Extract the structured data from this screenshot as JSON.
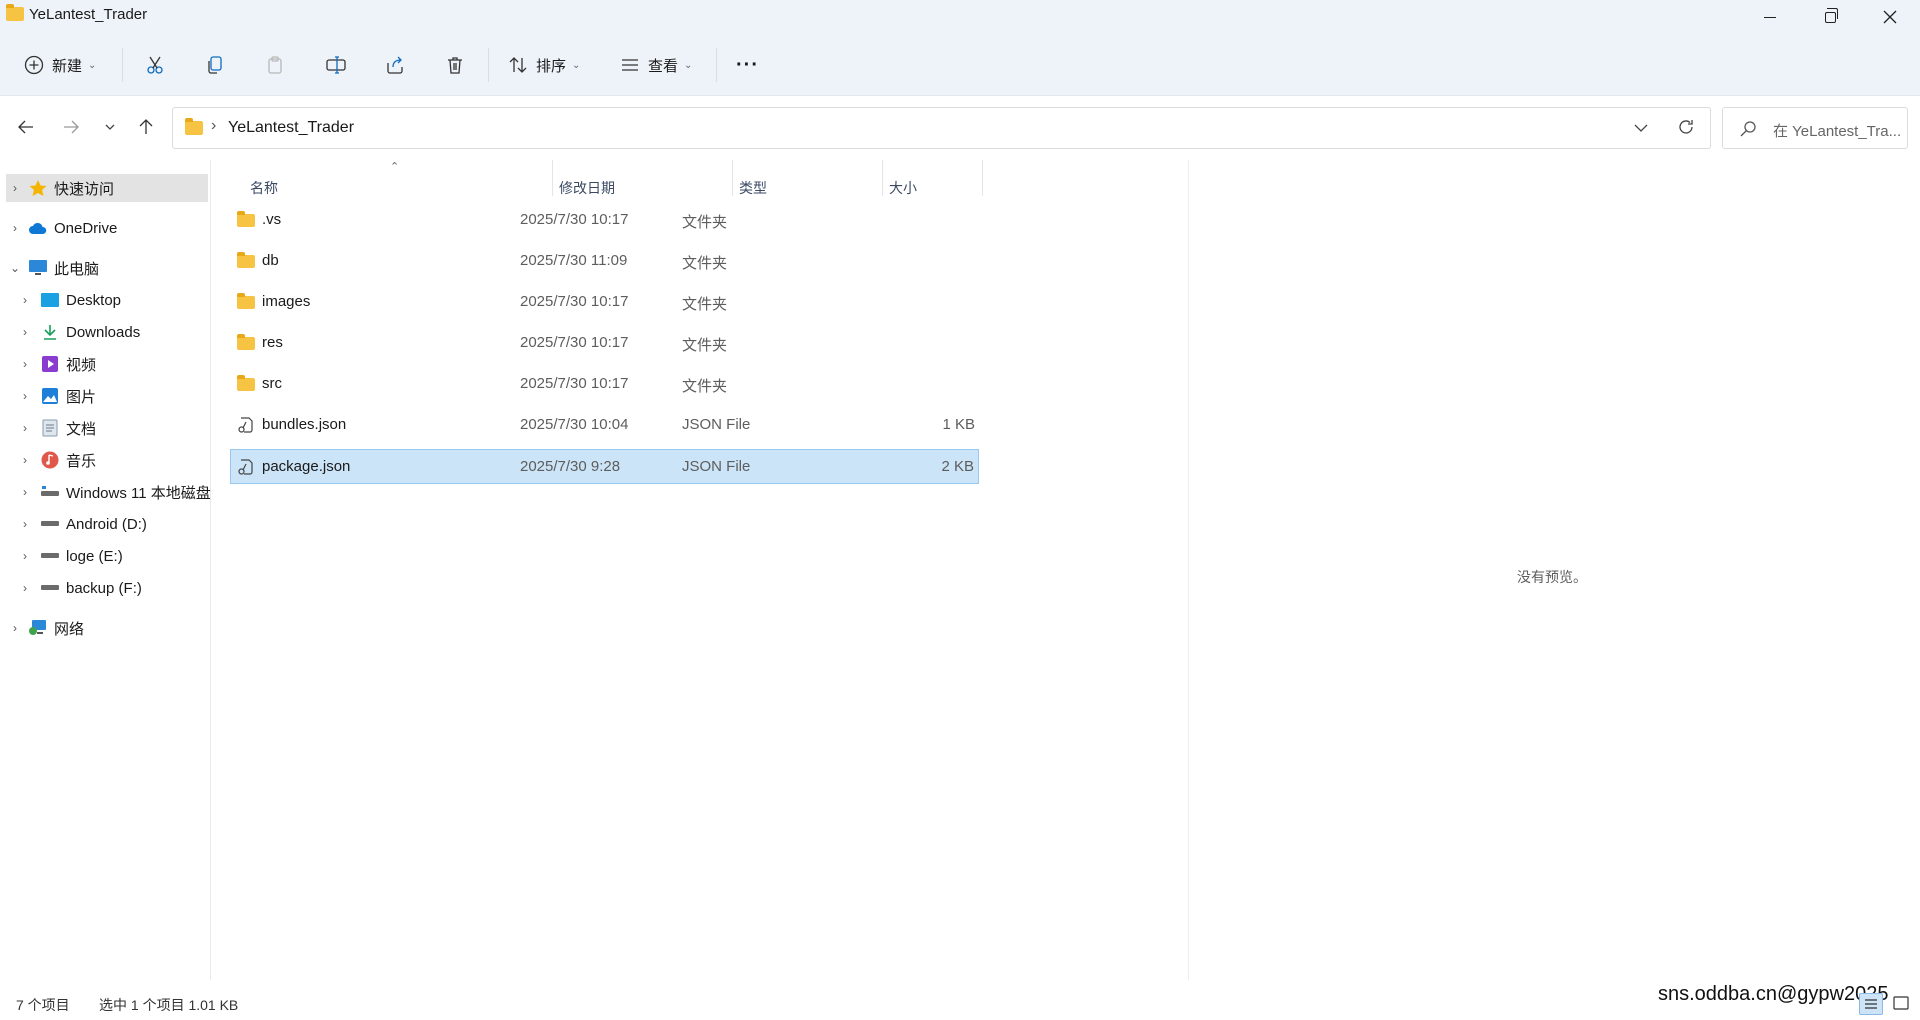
{
  "window": {
    "title": "YeLantest_Trader"
  },
  "toolbar": {
    "new_label": "新建",
    "sort_label": "排序",
    "view_label": "查看",
    "more_label": "···"
  },
  "address": {
    "path": "YeLantest_Trader",
    "separator": "›"
  },
  "search": {
    "placeholder": "在 YeLantest_Tra..."
  },
  "sidebar": {
    "items": [
      {
        "label": "快速访问",
        "icon": "star-icon"
      },
      {
        "label": "OneDrive",
        "icon": "cloud-icon"
      },
      {
        "label": "此电脑",
        "icon": "monitor-icon"
      },
      {
        "label": "Desktop",
        "icon": "desktop-icon"
      },
      {
        "label": "Downloads",
        "icon": "download-icon"
      },
      {
        "label": "视频",
        "icon": "video-icon"
      },
      {
        "label": "图片",
        "icon": "picture-icon"
      },
      {
        "label": "文档",
        "icon": "document-icon"
      },
      {
        "label": "音乐",
        "icon": "music-icon"
      },
      {
        "label": "Windows 11 本地磁盘",
        "icon": "drive-icon"
      },
      {
        "label": "Android (D:)",
        "icon": "drive-icon"
      },
      {
        "label": "loge (E:)",
        "icon": "drive-icon"
      },
      {
        "label": "backup (F:)",
        "icon": "drive-icon"
      },
      {
        "label": "网络",
        "icon": "network-icon"
      }
    ]
  },
  "columns": {
    "name": "名称",
    "date": "修改日期",
    "type": "类型",
    "size": "大小"
  },
  "files": [
    {
      "name": ".vs",
      "date": "2025/7/30 10:17",
      "type": "文件夹",
      "size": "",
      "kind": "folder"
    },
    {
      "name": "db",
      "date": "2025/7/30 11:09",
      "type": "文件夹",
      "size": "",
      "kind": "folder"
    },
    {
      "name": "images",
      "date": "2025/7/30 10:17",
      "type": "文件夹",
      "size": "",
      "kind": "folder"
    },
    {
      "name": "res",
      "date": "2025/7/30 10:17",
      "type": "文件夹",
      "size": "",
      "kind": "folder"
    },
    {
      "name": "src",
      "date": "2025/7/30 10:17",
      "type": "文件夹",
      "size": "",
      "kind": "folder"
    },
    {
      "name": "bundles.json",
      "date": "2025/7/30 10:04",
      "type": "JSON File",
      "size": "1 KB",
      "kind": "json"
    },
    {
      "name": "package.json",
      "date": "2025/7/30 9:28",
      "type": "JSON File",
      "size": "2 KB",
      "kind": "json"
    }
  ],
  "preview": {
    "empty_text": "没有预览。"
  },
  "status": {
    "item_count": "7 个项目",
    "selection": "选中 1 个项目  1.01 KB"
  },
  "watermark": "sns.oddba.cn@gypw2025",
  "colors": {
    "chrome_bg": "#eef3f9",
    "selection_bg": "#cce4f7",
    "selection_border": "#99c9ef",
    "folder": "#f6c343",
    "accent": "#0067c0"
  }
}
